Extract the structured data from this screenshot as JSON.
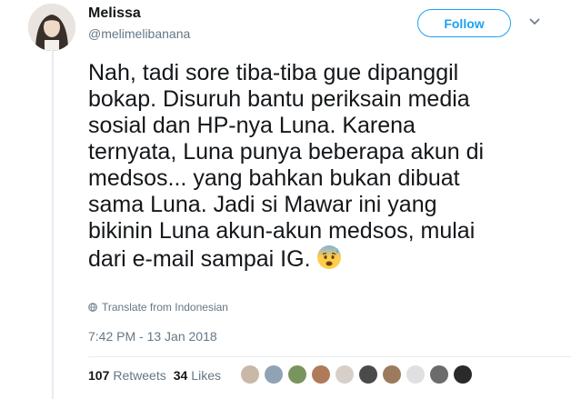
{
  "user": {
    "name": "Melissa",
    "handle": "@melimelibanana"
  },
  "follow_label": "Follow",
  "tweet": {
    "lines": [
      "Nah, tadi sore tiba-tiba gue dipanggil",
      "bokap. Disuruh bantu periksain media",
      "sosial dan HP-nya Luna. Karena",
      "ternyata, Luna punya beberapa akun di",
      "medsos... yang bahkan bukan dibuat",
      "sama Luna. Jadi si Mawar ini yang",
      "bikinin Luna akun-akun medsos, mulai",
      "dari e-mail sampai IG."
    ],
    "emoji": "anxious-face-with-sweat"
  },
  "translate_label": "Translate from Indonesian",
  "timestamp": "7:42 PM - 13 Jan 2018",
  "stats": {
    "retweets_count": "107",
    "retweets_label": "Retweets",
    "likes_count": "34",
    "likes_label": "Likes"
  },
  "liker_avatars": [
    {
      "color": "#c9b8a8"
    },
    {
      "color": "#8fa3b5"
    },
    {
      "color": "#7a9460"
    },
    {
      "color": "#b07b5a"
    },
    {
      "color": "#d8d0c8"
    },
    {
      "color": "#4a4a4a"
    },
    {
      "color": "#9c7a5c"
    },
    {
      "color": "#e0e0e0"
    },
    {
      "color": "#6b6b6b"
    },
    {
      "color": "#2a2a2a"
    }
  ],
  "colors": {
    "accent": "#1da1f2",
    "text": "#14171a",
    "muted": "#657786",
    "border": "#e6ecf0"
  }
}
